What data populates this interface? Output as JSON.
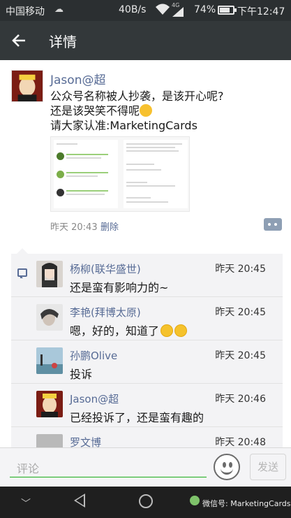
{
  "status_bar": {
    "carrier": "中国移动",
    "speed": "40B/s",
    "network": "4G",
    "battery": "74%",
    "time": "下午12:47"
  },
  "header": {
    "title": "详情"
  },
  "post": {
    "author": "Jason@超",
    "text_lines": [
      "公众号名称被人抄袭，是该开心呢?",
      "还是该哭笑不得呢",
      "请大家认准:MarketingCards"
    ],
    "time": "昨天 20:43",
    "delete_label": "删除"
  },
  "comments": [
    {
      "name": "杨柳(联华盛世)",
      "time": "昨天 20:45",
      "text": "还是蛮有影响力的~",
      "emoji_count": 0
    },
    {
      "name": "李艳(拜博太原)",
      "time": "昨天 20:45",
      "text": "嗯，好的，知道了",
      "emoji_count": 2
    },
    {
      "name": "孙鹏Olive",
      "time": "昨天 20:45",
      "text": "投诉",
      "emoji_count": 0
    },
    {
      "name": "Jason@超",
      "time": "昨天 20:46",
      "text": "已经投诉了，还是蛮有趣的",
      "emoji_count": 0
    },
    {
      "name": "罗文博",
      "time": "昨天 20:48",
      "text": "",
      "emoji_count": 0
    }
  ],
  "input": {
    "placeholder": "评论",
    "send_label": "发送"
  },
  "nav": {
    "watermark": "微信号: MarketingCards"
  },
  "colors": {
    "link": "#576b95",
    "accent_green": "#1aad19",
    "title_bar": "#33383a"
  }
}
